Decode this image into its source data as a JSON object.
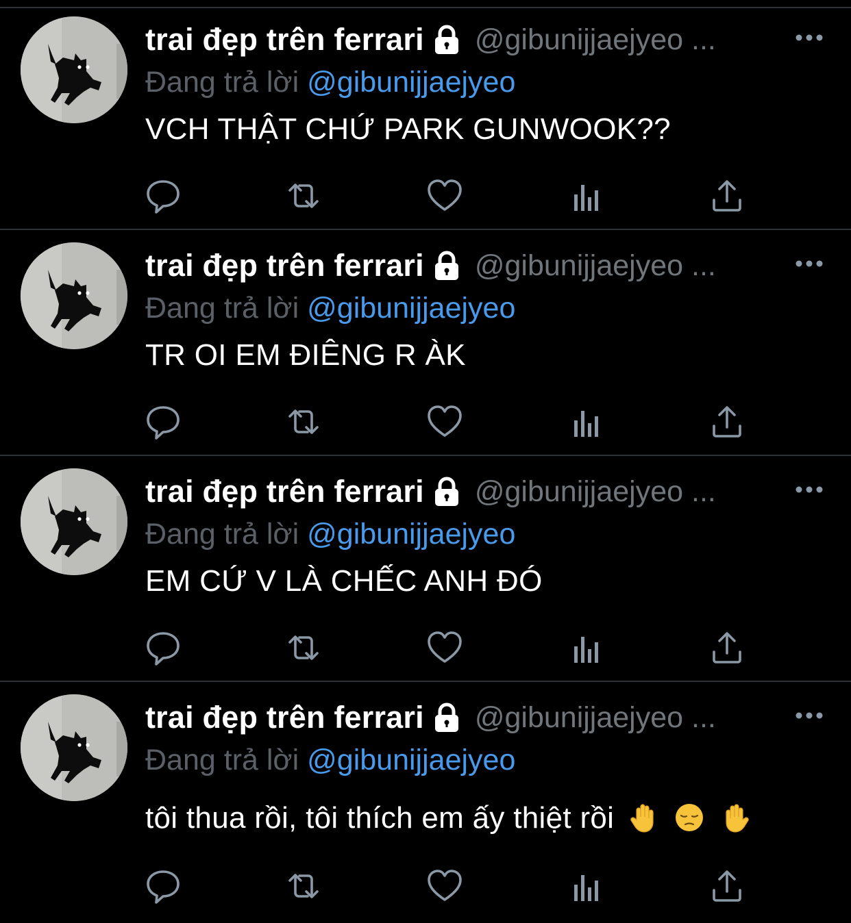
{
  "colors": {
    "background": "#000000",
    "divider": "#2f3336",
    "name": "#ffffff",
    "muted": "#71767b",
    "mention": "#4a9aeb",
    "icon": "#8b98a5"
  },
  "tweets": [
    {
      "display_name": "trai đẹp trên ferrari",
      "handle": "@gibunijjaejyeo ...",
      "reply_prefix": "Đang trả lời",
      "reply_mention": "@gibunijjaejyeo",
      "text": "VCH THẬT CHỨ PARK GUNWOOK??",
      "avatar_icon": "black-cat-avatar",
      "lock_icon": "lock-icon",
      "actions": [
        "reply-icon",
        "retweet-icon",
        "like-icon",
        "analytics-icon",
        "share-icon"
      ]
    },
    {
      "display_name": "trai đẹp trên ferrari",
      "handle": "@gibunijjaejyeo ...",
      "reply_prefix": "Đang trả lời",
      "reply_mention": "@gibunijjaejyeo",
      "text": "TR OI EM ĐIÊNG R ÀK",
      "avatar_icon": "black-cat-avatar",
      "lock_icon": "lock-icon",
      "actions": [
        "reply-icon",
        "retweet-icon",
        "like-icon",
        "analytics-icon",
        "share-icon"
      ]
    },
    {
      "display_name": "trai đẹp trên ferrari",
      "handle": "@gibunijjaejyeo ...",
      "reply_prefix": "Đang trả lời",
      "reply_mention": "@gibunijjaejyeo",
      "text": "EM CỨ V LÀ CHẾC ANH ĐÓ",
      "avatar_icon": "black-cat-avatar",
      "lock_icon": "lock-icon",
      "actions": [
        "reply-icon",
        "retweet-icon",
        "like-icon",
        "analytics-icon",
        "share-icon"
      ]
    },
    {
      "display_name": "trai đẹp trên ferrari",
      "handle": "@gibunijjaejyeo ...",
      "reply_prefix": "Đang trả lời",
      "reply_mention": "@gibunijjaejyeo",
      "text": "tôi thua rồi, tôi thích em ấy thiệt rồi",
      "emojis": [
        "raised-hand-emoji",
        "pensive-face-emoji",
        "raised-back-of-hand-emoji"
      ],
      "avatar_icon": "black-cat-avatar",
      "lock_icon": "lock-icon",
      "actions": [
        "reply-icon",
        "retweet-icon",
        "like-icon",
        "analytics-icon",
        "share-icon"
      ]
    }
  ]
}
